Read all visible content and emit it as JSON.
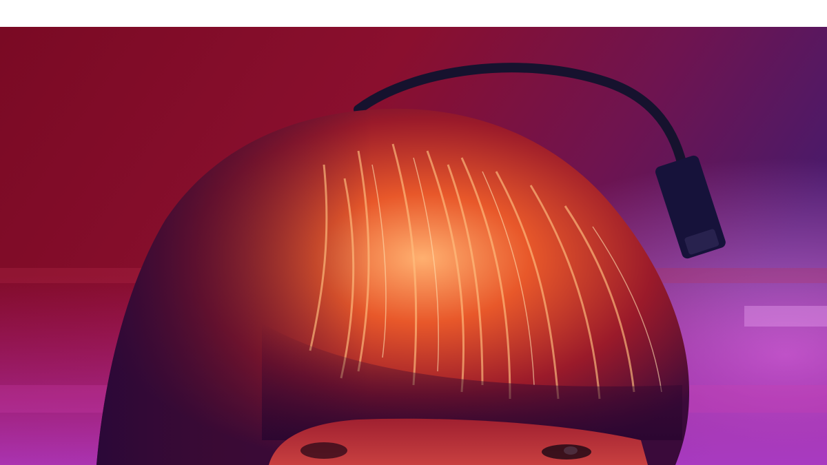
{
  "image": {
    "subject": "concert-performer-with-gooseneck-light",
    "palette": {
      "background_left": "#8a0f2a",
      "background_right": "#6a1a8a",
      "hair_highlight": "#ff8a4a",
      "hair_shadow": "#3a0a2a",
      "lamp": "#14123a",
      "haze": "#c85ad8"
    }
  }
}
